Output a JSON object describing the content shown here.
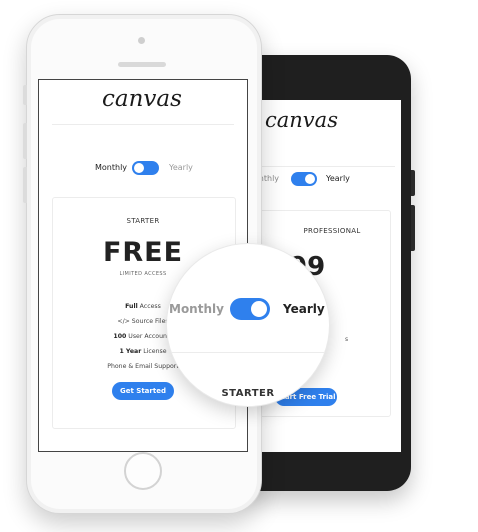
{
  "front_phone": {
    "logo": "canvas",
    "billing_toggle": {
      "monthly_label": "Monthly",
      "yearly_label": "Yearly"
    },
    "plan": {
      "name": "STARTER",
      "price": "FREE",
      "subtitle": "LIMITED ACCESS",
      "features": [
        {
          "bold": "Full",
          "text": " Access"
        },
        {
          "bold": "",
          "text": "</> Source Files"
        },
        {
          "bold": "100",
          "text": " User Accounts"
        },
        {
          "bold": "1 Year",
          "text": " License"
        },
        {
          "bold": "",
          "text": "Phone & Email Support"
        }
      ],
      "cta": "Get Started"
    }
  },
  "back_phone": {
    "logo": "canvas",
    "billing_toggle": {
      "monthly_label": "Monthly",
      "yearly_label": "Yearly"
    },
    "plan": {
      "name": "PROFESSIONAL",
      "price_partial": "99",
      "feature_partial": "s",
      "cta": "Start Free Trial"
    }
  },
  "magnifier": {
    "monthly_label": "Monthly",
    "yearly_label": "Yearly",
    "plan_name": "STARTER"
  },
  "colors": {
    "accent": "#2f80ed",
    "dark_phone": "#1f1f1f",
    "light_phone": "#fbfbfb"
  }
}
